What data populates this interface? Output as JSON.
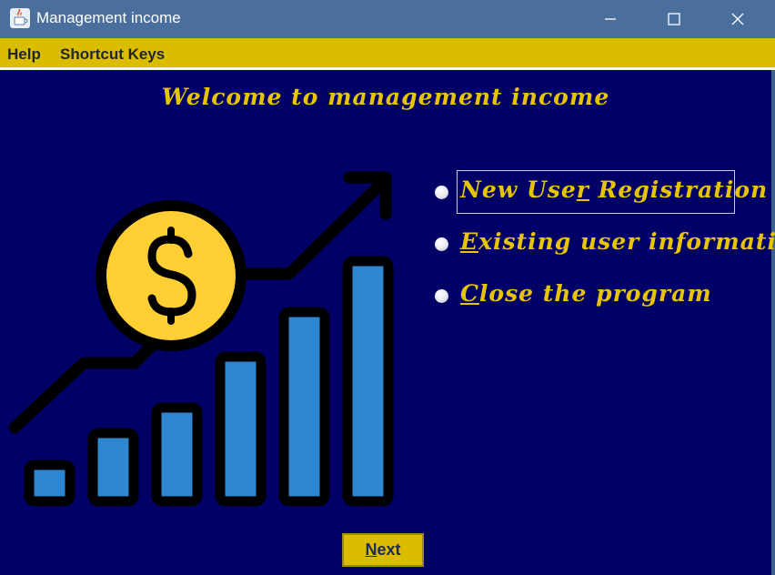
{
  "window": {
    "title": "Management income",
    "controls": [
      "minimize",
      "maximize",
      "close"
    ]
  },
  "menu": {
    "items": [
      {
        "label": "Help"
      },
      {
        "label": "Shortcut Keys"
      }
    ]
  },
  "main": {
    "welcome": "Welcome to management income",
    "options": [
      {
        "pre": "New Use",
        "mnemonic": "r",
        "post": " Registration",
        "selected": false,
        "focused": true
      },
      {
        "pre": "",
        "mnemonic": "E",
        "post": "xisting user information",
        "selected": false,
        "focused": false
      },
      {
        "pre": "",
        "mnemonic": "C",
        "post": "lose the program",
        "selected": false,
        "focused": false
      }
    ],
    "next_button": {
      "mnemonic": "N",
      "rest": "ext"
    }
  },
  "illustration": {
    "icon": "growth-chart-dollar-icon",
    "colors": {
      "background": "#000066",
      "outline": "#000000",
      "bars": "#2f86d0",
      "coin": "#ffcf33"
    }
  }
}
